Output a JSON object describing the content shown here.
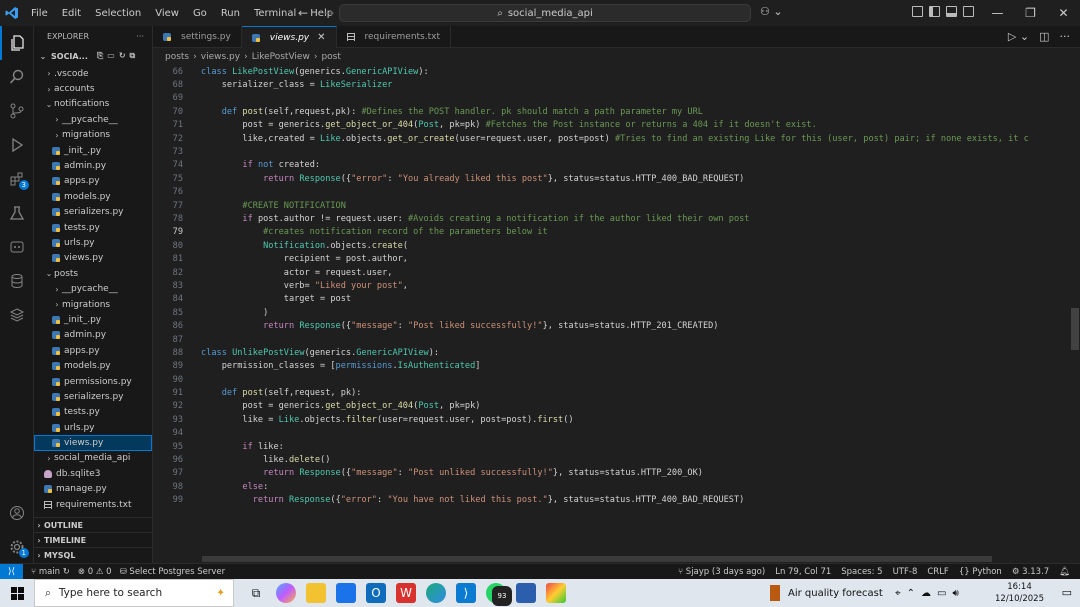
{
  "titlebar": {
    "menu": [
      "File",
      "Edit",
      "Selection",
      "View",
      "Go",
      "Run",
      "Terminal",
      "Help"
    ],
    "search": "social_media_api"
  },
  "sidebar": {
    "header": "EXPLORER",
    "project": "SOCIA...",
    "items": [
      {
        "label": ".vscode",
        "type": "folder",
        "open": false,
        "depth": 1
      },
      {
        "label": "accounts",
        "type": "folder",
        "open": false,
        "depth": 1
      },
      {
        "label": "notifications",
        "type": "folder",
        "open": true,
        "depth": 1
      },
      {
        "label": "__pycache__",
        "type": "folder",
        "open": false,
        "depth": 2
      },
      {
        "label": "migrations",
        "type": "folder",
        "open": false,
        "depth": 2
      },
      {
        "label": "_init_.py",
        "type": "py",
        "depth": 2
      },
      {
        "label": "admin.py",
        "type": "py",
        "depth": 2
      },
      {
        "label": "apps.py",
        "type": "py",
        "depth": 2
      },
      {
        "label": "models.py",
        "type": "py",
        "depth": 2
      },
      {
        "label": "serializers.py",
        "type": "py",
        "depth": 2
      },
      {
        "label": "tests.py",
        "type": "py",
        "depth": 2
      },
      {
        "label": "urls.py",
        "type": "py",
        "depth": 2
      },
      {
        "label": "views.py",
        "type": "py",
        "depth": 2
      },
      {
        "label": "posts",
        "type": "folder",
        "open": true,
        "depth": 1
      },
      {
        "label": "__pycache__",
        "type": "folder",
        "open": false,
        "depth": 2
      },
      {
        "label": "migrations",
        "type": "folder",
        "open": false,
        "depth": 2
      },
      {
        "label": "_init_.py",
        "type": "py",
        "depth": 2
      },
      {
        "label": "admin.py",
        "type": "py",
        "depth": 2
      },
      {
        "label": "apps.py",
        "type": "py",
        "depth": 2
      },
      {
        "label": "models.py",
        "type": "py",
        "depth": 2
      },
      {
        "label": "permissions.py",
        "type": "py",
        "depth": 2
      },
      {
        "label": "serializers.py",
        "type": "py",
        "depth": 2
      },
      {
        "label": "tests.py",
        "type": "py",
        "depth": 2
      },
      {
        "label": "urls.py",
        "type": "py",
        "depth": 2
      },
      {
        "label": "views.py",
        "type": "py",
        "depth": 2,
        "selected": true
      },
      {
        "label": "social_media_api",
        "type": "folder",
        "open": false,
        "depth": 1
      },
      {
        "label": "db.sqlite3",
        "type": "db",
        "depth": 1
      },
      {
        "label": "manage.py",
        "type": "py",
        "depth": 1
      },
      {
        "label": "requirements.txt",
        "type": "txt",
        "depth": 1
      }
    ],
    "footer": [
      "OUTLINE",
      "TIMELINE",
      "MYSQL"
    ]
  },
  "tabs": [
    {
      "label": "settings.py",
      "active": false
    },
    {
      "label": "views.py",
      "active": true
    },
    {
      "label": "requirements.txt",
      "active": false
    }
  ],
  "breadcrumb": [
    "posts",
    "views.py",
    "LikePostView",
    "post"
  ],
  "code": {
    "current_line": 79,
    "lines": [
      {
        "n": 66,
        "t": "class LikePostView(generics.GenericAPIView):"
      },
      {
        "n": 68,
        "t": "    serializer_class = LikeSerializer"
      },
      {
        "n": 69,
        "t": ""
      },
      {
        "n": 70,
        "t": "    def post(self,request,pk): #Defines the POST handler. pk should match a path parameter my URL"
      },
      {
        "n": 71,
        "t": "        post = generics.get_object_or_404(Post, pk=pk) #Fetches the Post instance or returns a 404 if it doesn't exist."
      },
      {
        "n": 72,
        "t": "        like,created = Like.objects.get_or_create(user=request.user, post=post) #Tries to find an existing Like for this (user, post) pair; if none exists, it c"
      },
      {
        "n": 73,
        "t": ""
      },
      {
        "n": 74,
        "t": "        if not created:"
      },
      {
        "n": 75,
        "t": "            return Response({\"error\": \"You already liked this post\"}, status=status.HTTP_400_BAD_REQUEST)"
      },
      {
        "n": 76,
        "t": ""
      },
      {
        "n": 77,
        "t": "        #CREATE NOTIFICATION"
      },
      {
        "n": 78,
        "t": "        if post.author != request.user: #Avoids creating a notification if the author liked their own post"
      },
      {
        "n": 79,
        "t": "            #creates notification record of the parameters below it"
      },
      {
        "n": 80,
        "t": "            Notification.objects.create("
      },
      {
        "n": 81,
        "t": "                recipient = post.author,"
      },
      {
        "n": 82,
        "t": "                actor = request.user,"
      },
      {
        "n": 83,
        "t": "                verb= \"Liked your post\","
      },
      {
        "n": 84,
        "t": "                target = post"
      },
      {
        "n": 85,
        "t": "            )"
      },
      {
        "n": 86,
        "t": "            return Response({\"message\": \"Post liked successfully!\"}, status=status.HTTP_201_CREATED)"
      },
      {
        "n": 87,
        "t": ""
      },
      {
        "n": 88,
        "t": "class UnlikePostView(generics.GenericAPIView):"
      },
      {
        "n": 89,
        "t": "    permission_classes = [permissions.IsAuthenticated]"
      },
      {
        "n": 90,
        "t": ""
      },
      {
        "n": 91,
        "t": "    def post(self,request, pk):"
      },
      {
        "n": 92,
        "t": "        post = generics.get_object_or_404(Post, pk=pk)"
      },
      {
        "n": 93,
        "t": "        like = Like.objects.filter(user=request.user, post=post).first()"
      },
      {
        "n": 94,
        "t": ""
      },
      {
        "n": 95,
        "t": "        if like:"
      },
      {
        "n": 96,
        "t": "            like.delete()"
      },
      {
        "n": 97,
        "t": "            return Response({\"message\": \"Post unliked successfully!\"}, status=status.HTTP_200_OK)"
      },
      {
        "n": 98,
        "t": "        else:"
      },
      {
        "n": 99,
        "t": "          return Response({\"error\": \"You have not liked this post.\"}, status=status.HTTP_400_BAD_REQUEST)"
      }
    ]
  },
  "statusbar": {
    "branch": "main",
    "problems": "0",
    "warnings": "0",
    "select_db": "Select Postgres Server",
    "blame": "Sjayp (3 days ago)",
    "position": "Ln 79, Col 71",
    "spaces": "Spaces: 5",
    "encoding": "UTF-8",
    "eol": "CRLF",
    "language": "Python",
    "version": "3.13.7"
  },
  "taskbar": {
    "search_placeholder": "Type here to search",
    "weather": "Air quality forecast",
    "time": "16:14",
    "date": "12/10/2025",
    "whatsapp_badge": "93"
  },
  "activity_badges": {
    "extensions": "3",
    "settings": "1"
  }
}
